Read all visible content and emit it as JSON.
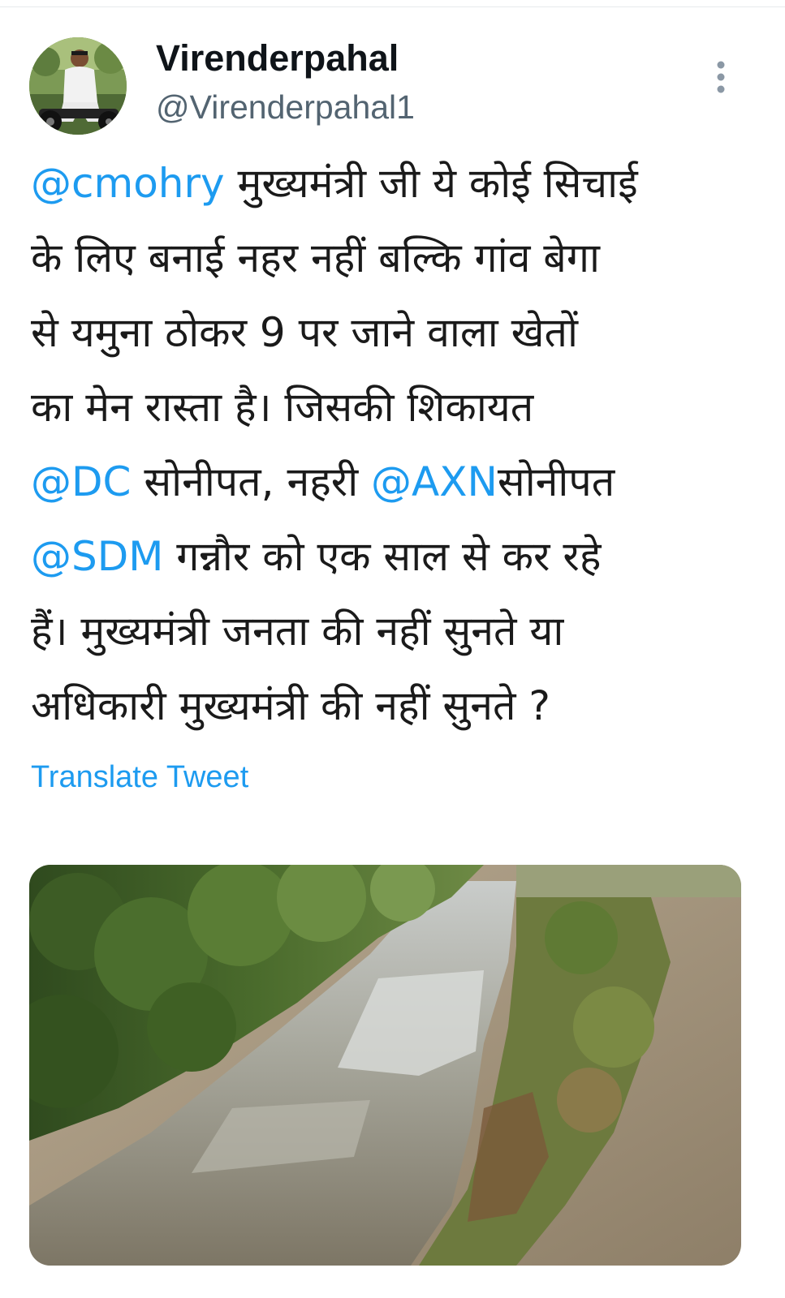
{
  "tweet": {
    "author": {
      "display_name": "Virenderpahal",
      "handle": "@Virenderpahal1"
    },
    "text_lines": [
      {
        "mention": "@cmohry",
        "text": " मुख्यमंत्री जी ये कोई सिचाई"
      },
      {
        "text": "के लिए बनाई नहर नहीं बल्कि गांव बेगा"
      },
      {
        "text": "से यमुना ठोकर 9 पर जाने वाला खेतों"
      },
      {
        "text": "का मेन रास्ता है। जिसकी शिकायत"
      },
      {
        "mention": "@DC",
        "text": " सोनीपत, नहरी ",
        "mention2": "@AXN",
        "text2": "सोनीपत"
      },
      {
        "mention": "@SDM",
        "text": " गन्नौर को एक साल से कर रहे"
      },
      {
        "text": "हैं। मुख्यमंत्री जनता की नहीं सुनते या"
      },
      {
        "text": "अधिकारी मुख्यमंत्री की नहीं सुनते ?"
      }
    ],
    "translate_label": "Translate Tweet"
  },
  "colors": {
    "link": "#1d9bf0",
    "secondary_text": "#536471",
    "primary_text": "#0f1419"
  },
  "icons": {
    "more": "more-vertical-icon"
  }
}
